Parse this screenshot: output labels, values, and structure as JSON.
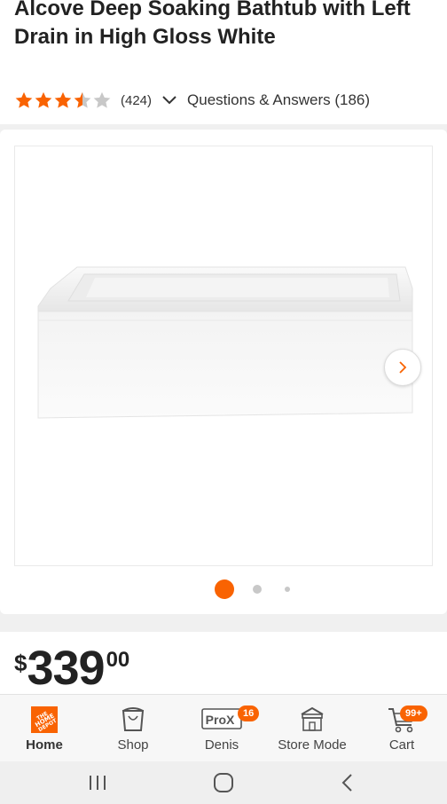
{
  "product": {
    "title": "Alcove Deep Soaking Bathtub with Left Drain in High Gloss White",
    "rating": 3.5,
    "rating_max": 5,
    "review_count": "(424)",
    "qa_label": "Questions & Answers (186)"
  },
  "gallery": {
    "dot_count": 3,
    "active_dot": 1
  },
  "price": {
    "currency": "$",
    "dollars": "339",
    "cents": "00"
  },
  "nav": {
    "items": [
      {
        "label": "Home",
        "icon": "home-depot-logo-icon",
        "active": true
      },
      {
        "label": "Shop",
        "icon": "paint-bucket-icon"
      },
      {
        "label": "Denis",
        "icon": "pro-xtra-icon",
        "badge": "16"
      },
      {
        "label": "Store Mode",
        "icon": "store-icon"
      },
      {
        "label": "Cart",
        "icon": "cart-icon",
        "badge": "99+"
      }
    ]
  },
  "colors": {
    "accent": "#f96302",
    "star_empty": "#c8c8c8"
  }
}
